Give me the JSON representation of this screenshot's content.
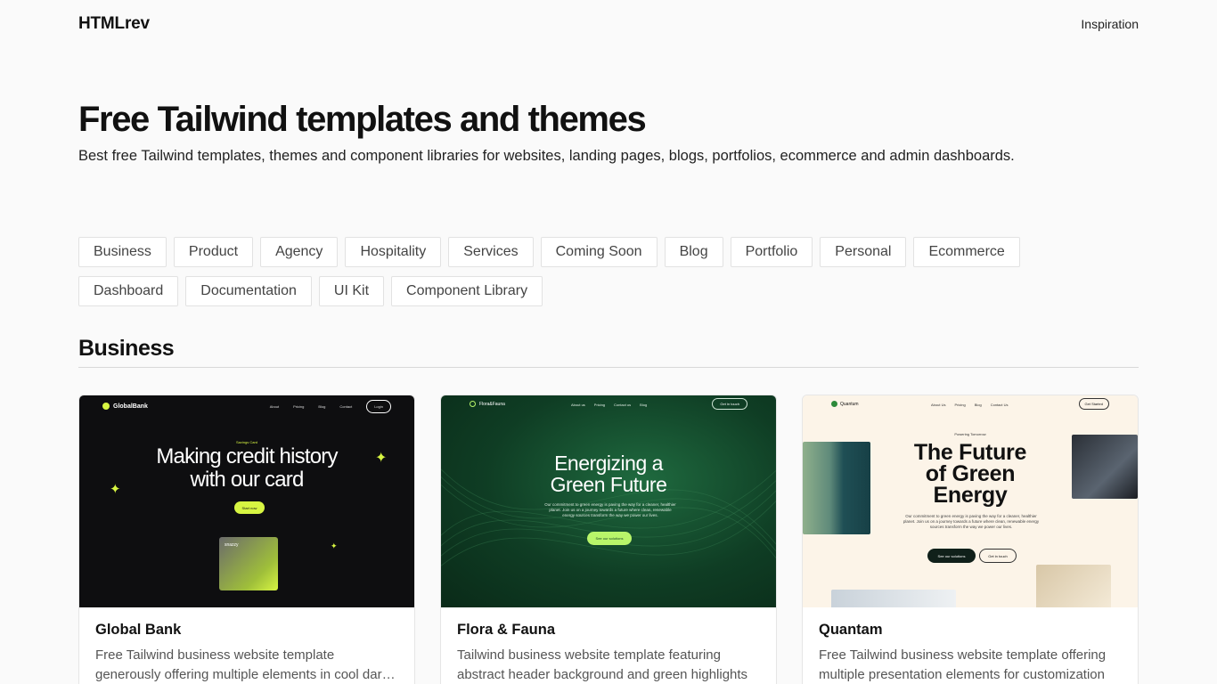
{
  "header": {
    "logo": "HTMLrev",
    "nav": [
      {
        "label": "Inspiration"
      }
    ]
  },
  "hero": {
    "title": "Free Tailwind templates and themes",
    "subtitle": "Best free Tailwind templates, themes and component libraries for websites, landing pages, blogs, portfolios, ecommerce and admin dashboards."
  },
  "filters": [
    "Business",
    "Product",
    "Agency",
    "Hospitality",
    "Services",
    "Coming Soon",
    "Blog",
    "Portfolio",
    "Personal",
    "Ecommerce",
    "Dashboard",
    "Documentation",
    "UI Kit",
    "Component Library"
  ],
  "section": {
    "title": "Business"
  },
  "cards": [
    {
      "title": "Global Bank",
      "desc_line1": "Free Tailwind business website template",
      "desc_line2": "generously offering multiple elements in cool dark...",
      "thumb": {
        "logo": "GlobalBank",
        "nav": [
          "About",
          "Pricing",
          "Blog",
          "Contact"
        ],
        "pill": "Login",
        "eyebrow": "Savings Card",
        "headline_1": "Making credit history",
        "headline_2": "with our card",
        "cta": "Start now",
        "card_label": "snazzy",
        "accent": "#d7f542"
      }
    },
    {
      "title": "Flora & Fauna",
      "desc_line1": "Tailwind business website template featuring",
      "desc_line2": "abstract header background and green highlights",
      "thumb": {
        "logo": "Flora&Fauna",
        "nav": [
          "About us",
          "Pricing",
          "Contact us",
          "Blog"
        ],
        "pill": "Get in touch",
        "headline_1": "Energizing a",
        "headline_2": "Green Future",
        "para": "Our commitment to green energy is paving the way for a cleaner, healthier planet. Join us on a journey towards a future where clean, renewable energy sources transform the way we power our lives.",
        "cta": "See our solutions",
        "accent": "#b8f56a"
      }
    },
    {
      "title": "Quantam",
      "desc_line1": "Free Tailwind business website template offering",
      "desc_line2": "multiple presentation elements for customization",
      "thumb": {
        "logo": "Quantum",
        "nav": [
          "About Us",
          "Pricing",
          "Blog",
          "Contact Us"
        ],
        "pill": "Get Started",
        "eyebrow": "Powering Tomorrow",
        "headline_1": "The Future",
        "headline_2": "of Green",
        "headline_3": "Energy",
        "para": "Our commitment to green energy is paving the way for a cleaner, healthier planet. Join us on a journey towards a future where clean, renewable energy sources transform the way we power our lives.",
        "btn_primary": "See our solutions",
        "btn_secondary": "Get in touch",
        "accent": "#2d8a3a"
      }
    }
  ]
}
